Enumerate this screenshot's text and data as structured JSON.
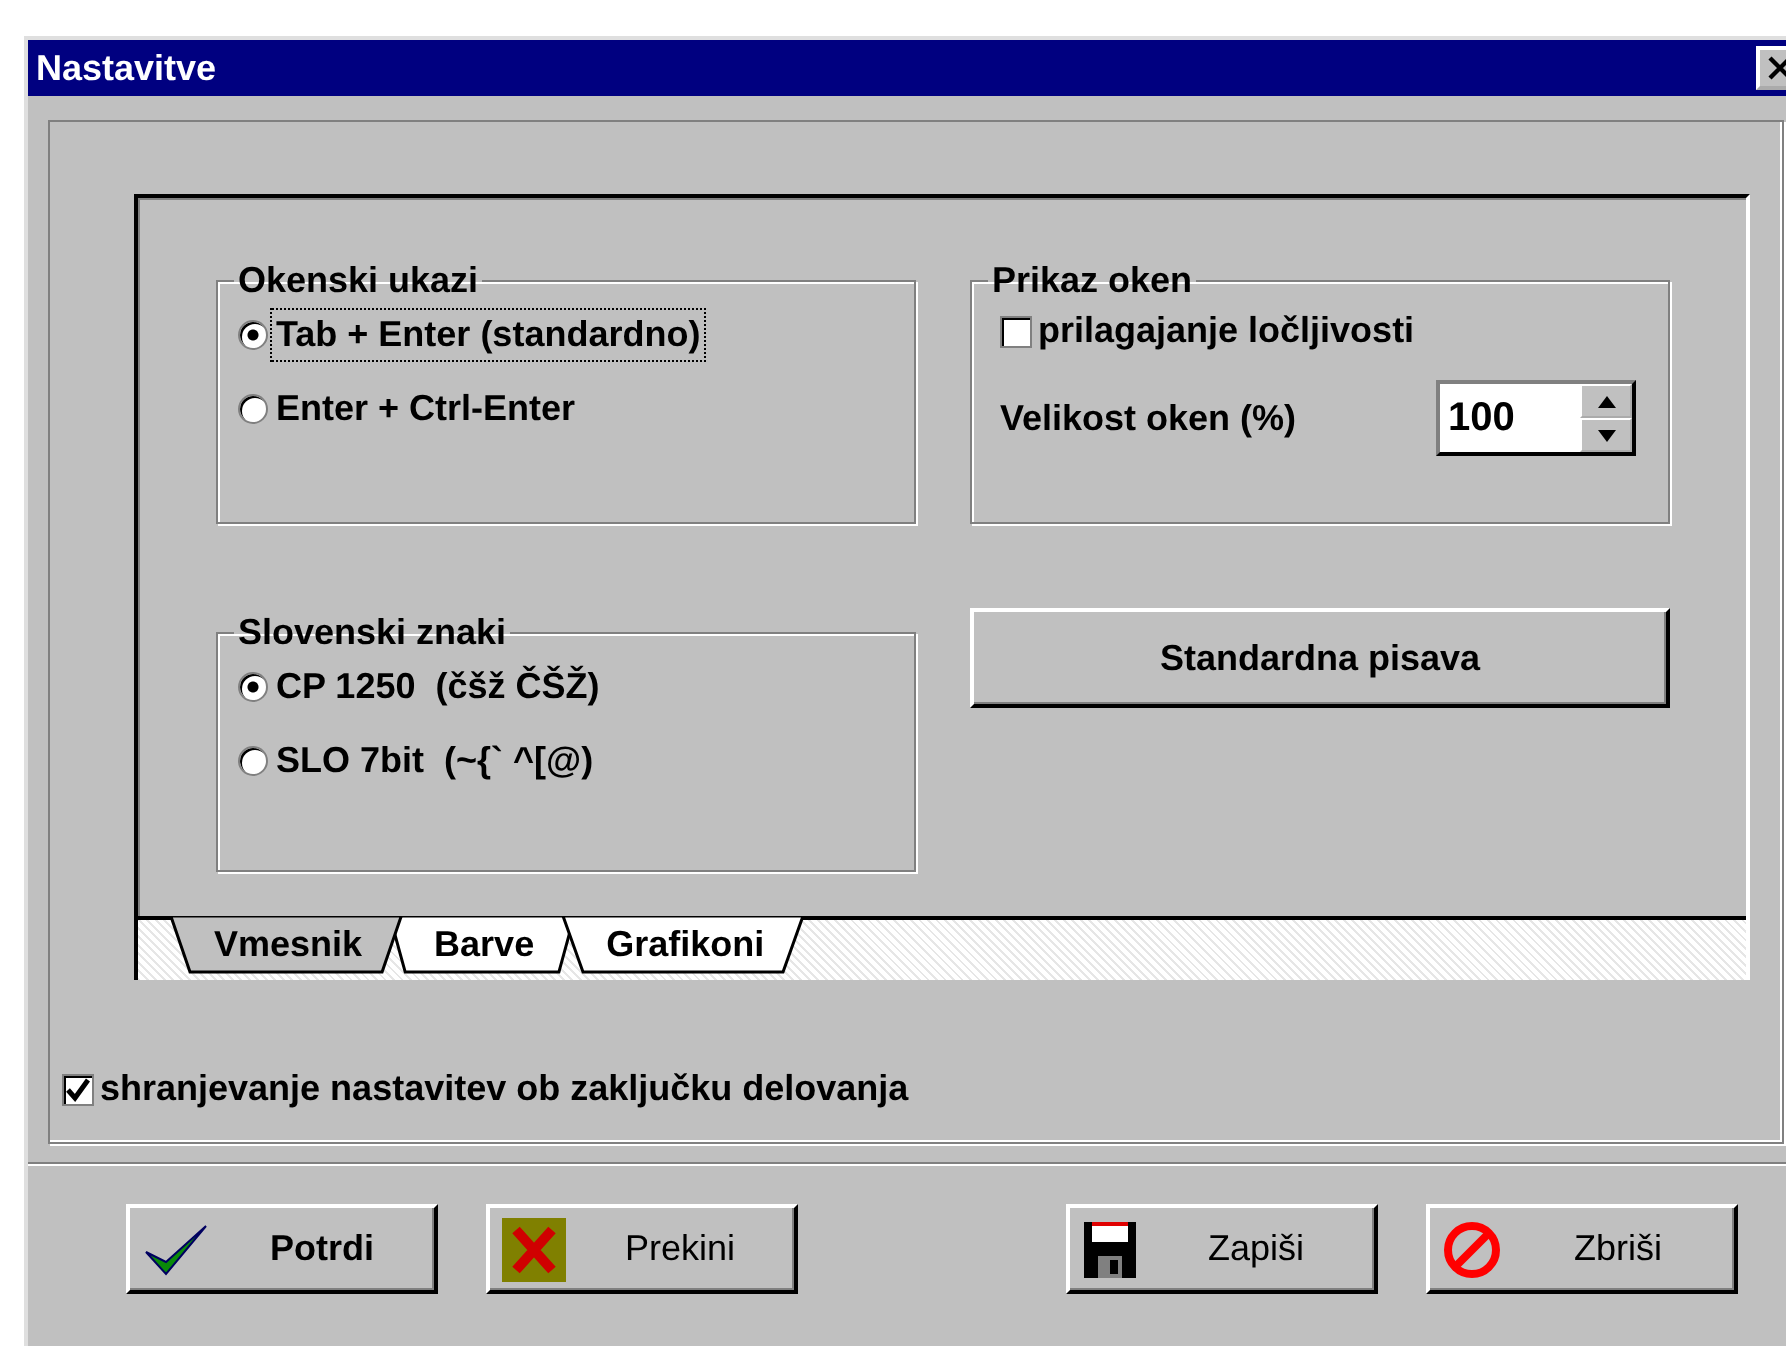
{
  "window": {
    "title": "Nastavitve"
  },
  "okenski_ukazi": {
    "title": "Okenski ukazi",
    "options": [
      {
        "label": "Tab + Enter (standardno)",
        "selected": true,
        "focused": true
      },
      {
        "label": "Enter + Ctrl-Enter",
        "selected": false,
        "focused": false
      }
    ]
  },
  "slovenski_znaki": {
    "title": "Slovenski znaki",
    "options": [
      {
        "label": "CP 1250  (čšž ČŠŽ)",
        "selected": true,
        "focused": false
      },
      {
        "label": "SLO 7bit  (~{` ^[@)",
        "selected": false,
        "focused": false
      }
    ]
  },
  "prikaz_oken": {
    "title": "Prikaz oken",
    "checkbox": {
      "label": "prilagajanje ločljivosti",
      "checked": false
    },
    "size": {
      "label": "Velikost oken (%)",
      "value": "100"
    }
  },
  "font_button": "Standardna pisava",
  "tabs": [
    {
      "label": "Vmesnik",
      "selected": true
    },
    {
      "label": "Barve",
      "selected": false
    },
    {
      "label": "Grafikoni",
      "selected": false
    }
  ],
  "save_on_exit": {
    "label": "shranjevanje nastavitev ob zaključku delovanja",
    "checked": true
  },
  "buttons": [
    {
      "label": "Potrdi",
      "kind": "confirm",
      "default": true
    },
    {
      "label": "Prekini",
      "kind": "cancel",
      "default": false
    },
    {
      "label": "Zapiši",
      "kind": "save",
      "default": false
    },
    {
      "label": "Zbriši",
      "kind": "delete",
      "default": false
    }
  ]
}
